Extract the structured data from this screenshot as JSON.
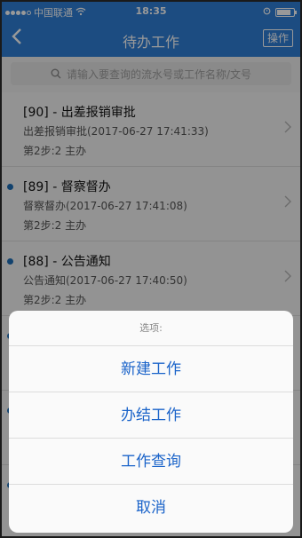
{
  "status": {
    "carrier": "中国联通",
    "time": "18:35"
  },
  "nav": {
    "title": "待办工作",
    "action": "操作"
  },
  "search": {
    "placeholder": "请输入要查询的流水号或工作名称/文号"
  },
  "items": [
    {
      "title": "[90] - 出差报销审批",
      "sub": "出差报销审批(2017-06-27 17:41:33)",
      "step": "第2步:2 主办",
      "unread": false
    },
    {
      "title": "[89] - 督察督办",
      "sub": "督察督办(2017-06-27 17:41:08)",
      "step": "第2步:2 主办",
      "unread": true
    },
    {
      "title": "[88] - 公告通知",
      "sub": "公告通知(2017-06-27 17:40:50)",
      "step": "第2步:2 主办",
      "unread": true
    },
    {
      "title": "",
      "sub": "",
      "step": "",
      "unread": true
    },
    {
      "title": "",
      "sub": "",
      "step": "",
      "unread": true
    },
    {
      "title": "",
      "sub": "",
      "step": "",
      "unread": true
    }
  ],
  "sheet": {
    "header": "选项:",
    "options": [
      "新建工作",
      "办结工作",
      "工作查询",
      "取消"
    ]
  },
  "colors": {
    "brand": "#2f7fd8",
    "actionText": "#1a63c9",
    "unreadDot": "#1e6fb8"
  },
  "icons": {
    "back": "chevron-left-icon",
    "search": "search-icon",
    "chevron": "chevron-right-icon"
  }
}
